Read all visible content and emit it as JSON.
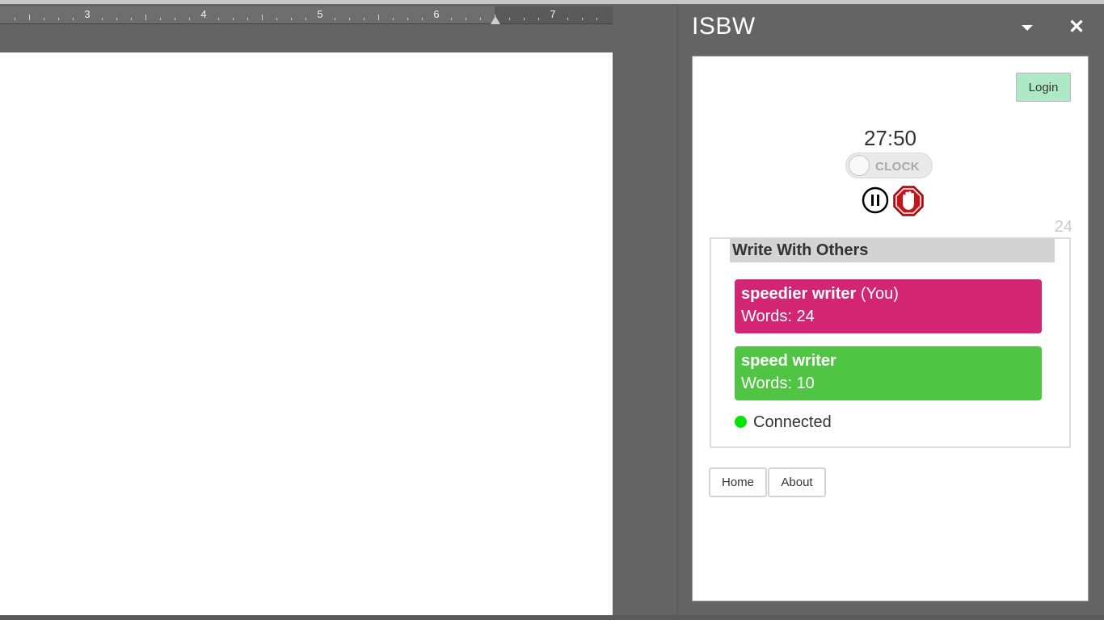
{
  "ruler": {
    "numbers": [
      "3",
      "4",
      "5",
      "6",
      "7"
    ]
  },
  "pane": {
    "title": "ISBW"
  },
  "addin": {
    "login_label": "Login",
    "timer": "27:50",
    "clock_toggle_label": "CLOCK",
    "word_count": "24",
    "others_title": "Write With Others",
    "writers": [
      {
        "name": "speedier writer",
        "suffix": " (You)",
        "words": "Words: 24",
        "color": "#d22573"
      },
      {
        "name": "speed writer",
        "suffix": "",
        "words": "Words: 10",
        "color": "#4fc543"
      }
    ],
    "status": "Connected",
    "status_color": "#00e600",
    "nav": {
      "home": "Home",
      "about": "About"
    }
  },
  "icons": {
    "pause": "pause-icon",
    "stop": "stop-hand-icon",
    "dropdown": "chevron-down-icon",
    "close": "close-icon"
  }
}
